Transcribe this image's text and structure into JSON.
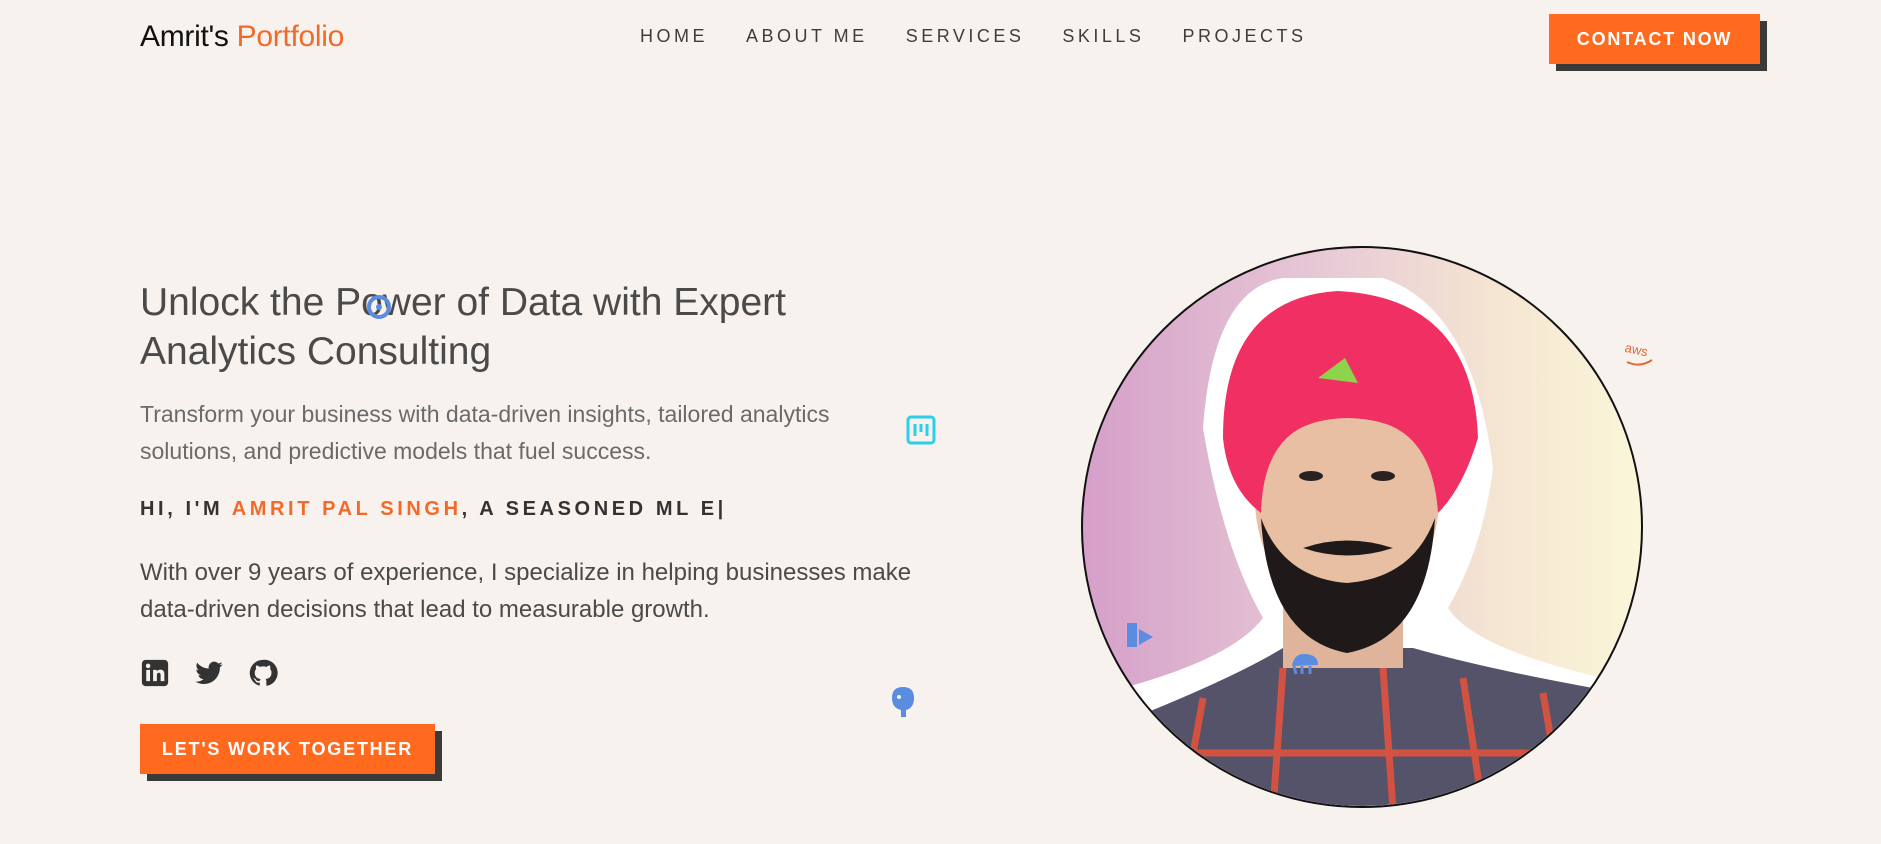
{
  "header": {
    "logo_main": "Amrit's",
    "logo_accent": "Portfolio",
    "nav": [
      "HOME",
      "ABOUT ME",
      "SERVICES",
      "SKILLS",
      "PROJECTS"
    ],
    "contact_label": "CONTACT NOW"
  },
  "hero": {
    "title": "Unlock the Power of Data with Expert Analytics Consulting",
    "subtitle": "Transform your business with data-driven insights, tailored analytics solutions, and predictive models that fuel success.",
    "intro_prefix": "HI, I'M ",
    "intro_name": "AMRIT PAL SINGH",
    "intro_suffix": ", A SEASONED ML E|",
    "description": "With over 9 years of experience, I specialize in helping businesses make data-driven decisions that lead to measurable growth.",
    "cta_label": "LET'S WORK TOGETHER"
  },
  "social": [
    "linkedin-icon",
    "twitter-icon",
    "github-icon"
  ],
  "floating_icons": {
    "aws_label": "aws"
  },
  "colors": {
    "accent": "#ff6a1f",
    "background": "#f7f2ee",
    "shadow": "#3a3a3a"
  }
}
